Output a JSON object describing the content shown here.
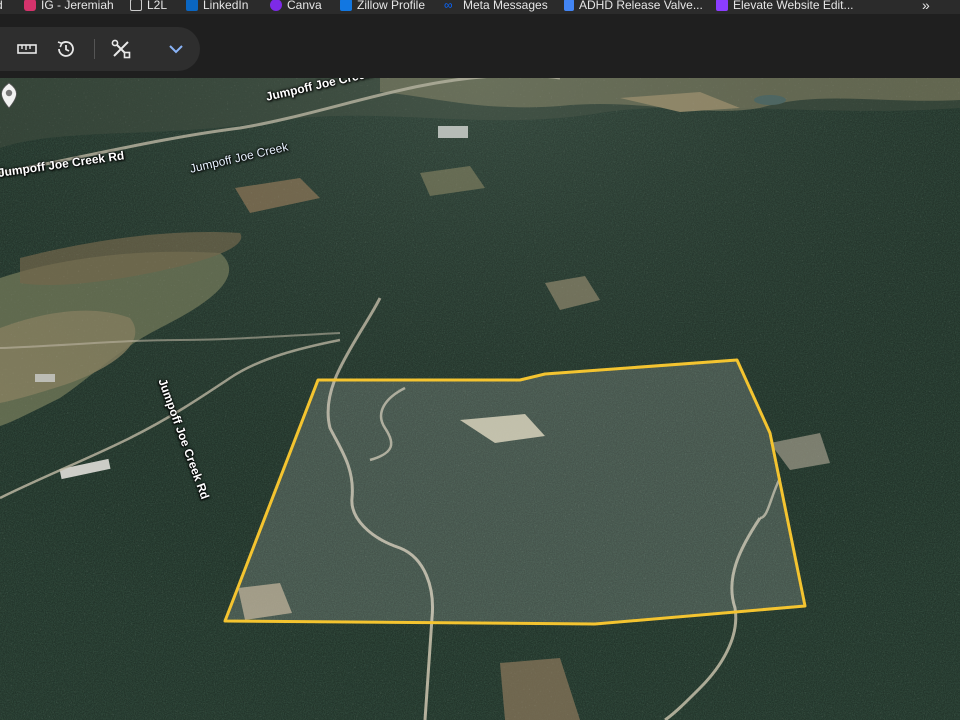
{
  "bookmarks": [
    {
      "label": "d",
      "icon": "",
      "color": ""
    },
    {
      "label": "IG - Jeremiah",
      "icon": "instagram-icon",
      "color": "#d6336c"
    },
    {
      "label": "L2L",
      "icon": "home-icon",
      "color": "#cccccc"
    },
    {
      "label": "LinkedIn",
      "icon": "linkedin-icon",
      "color": "#0a66c2"
    },
    {
      "label": "Canva",
      "icon": "canva-icon",
      "color": "#7d2ae8"
    },
    {
      "label": "Zillow Profile",
      "icon": "zillow-icon",
      "color": "#1277e1"
    },
    {
      "label": "Meta Messages",
      "icon": "meta-icon",
      "color": "#0866ff"
    },
    {
      "label": "ADHD Release Valve...",
      "icon": "doc-icon",
      "color": "#4285f4"
    },
    {
      "label": "Elevate Website Edit...",
      "icon": "page-icon",
      "color": "#8b3dff"
    }
  ],
  "overflow_label": "»",
  "toolbar": {
    "tools": [
      "ruler-icon",
      "history-icon",
      "tools-icon",
      "chevron-down-icon"
    ]
  },
  "map": {
    "labels": {
      "road_top": "Jumpoff Joe Creek Rd",
      "road_left": "Jumpoff Joe Creek Rd",
      "creek": "Jumpoff Joe Creek",
      "road_vertical": "Jumpoff Joe Creek Rd"
    },
    "colors": {
      "parcel_outline": "#f4c430",
      "forest": "#23352b"
    }
  }
}
